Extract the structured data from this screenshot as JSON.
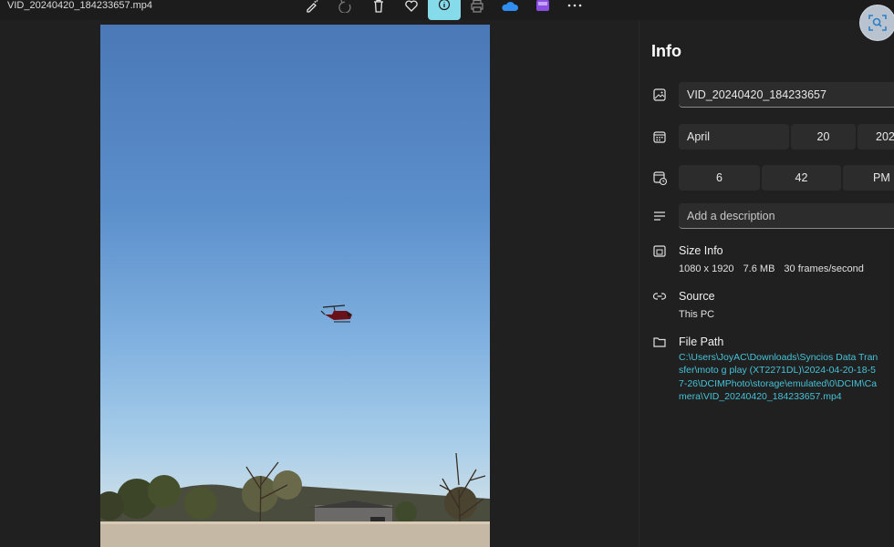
{
  "window": {
    "title": "VID_20240420_184233657.mp4"
  },
  "toolbar": {
    "icons": [
      "edit-icon",
      "rotate-icon",
      "delete-icon",
      "favorite-icon",
      "info-icon",
      "print-icon",
      "onedrive-icon",
      "clipchamp-icon",
      "more-icon"
    ],
    "active": "info-icon"
  },
  "info": {
    "title": "Info",
    "filename": "VID_20240420_184233657",
    "date": {
      "month": "April",
      "day": "20",
      "year": "202"
    },
    "time": {
      "hour": "6",
      "minute": "42",
      "period": "PM"
    },
    "description_placeholder": "Add a description",
    "size": {
      "title": "Size Info",
      "dimensions": "1080 x 1920",
      "filesize": "7.6 MB",
      "framerate": "30 frames/second"
    },
    "source": {
      "title": "Source",
      "value": "This PC"
    },
    "path": {
      "title": "File Path",
      "value": "C:\\Users\\JoyAC\\Downloads\\Syncios Data Transfer\\moto g play (XT2271DL)\\2024-04-20-18-57-26\\DCIMPhoto\\storage\\emulated\\0\\DCIM\\Camera\\VID_20240420_184233657.mp4"
    }
  },
  "colors": {
    "accent": "#86dbeb",
    "link": "#45c3d8",
    "background": "#202020"
  }
}
